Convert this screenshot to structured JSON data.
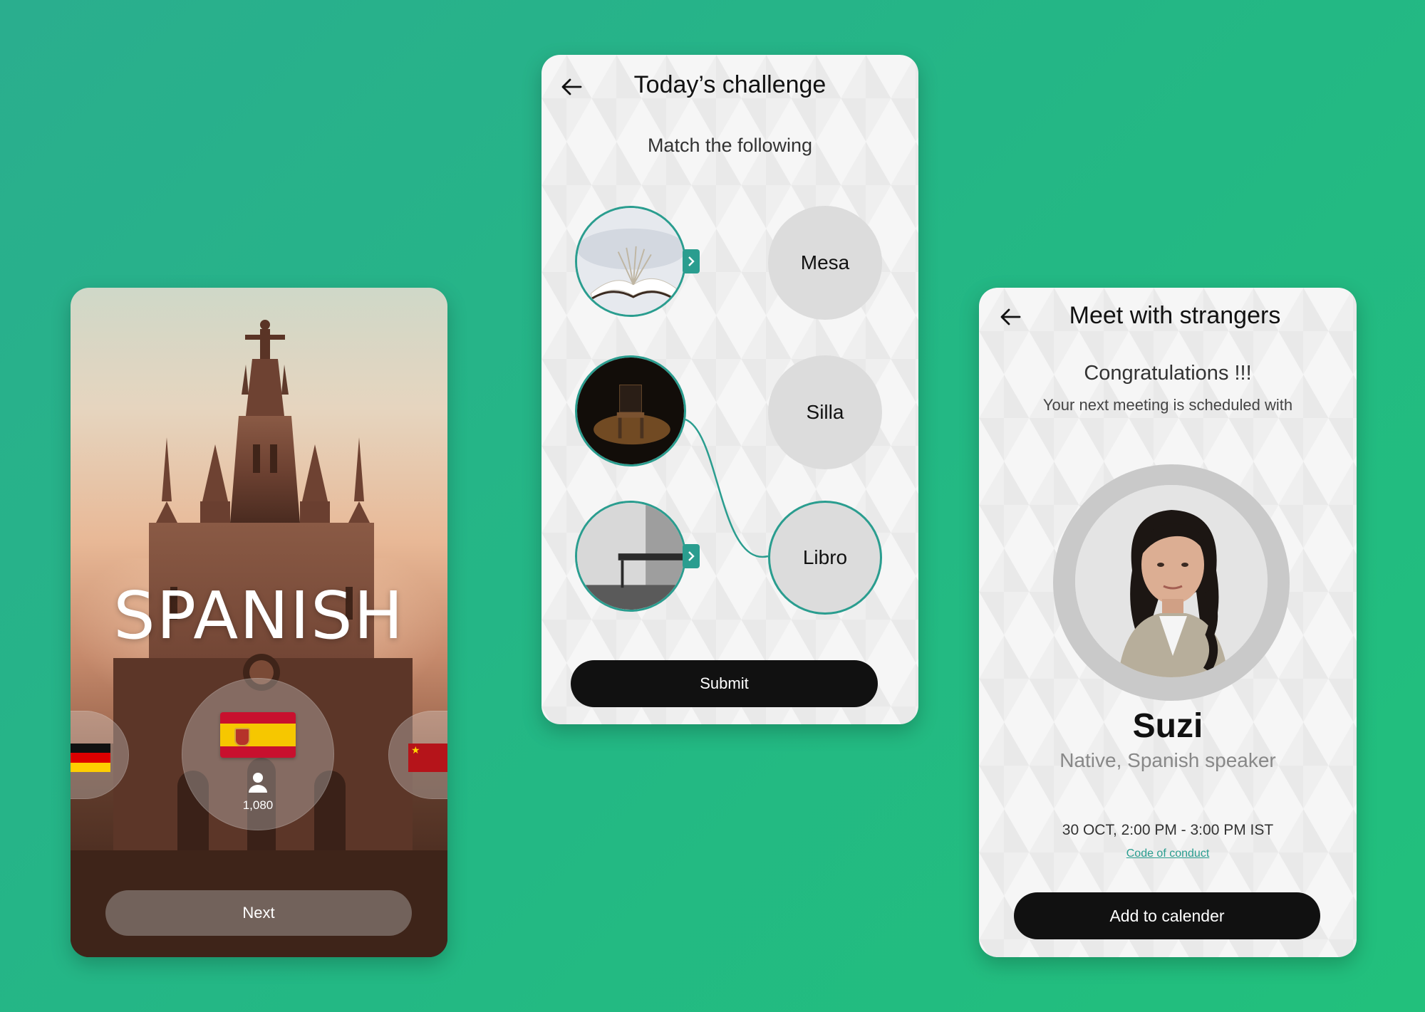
{
  "colors": {
    "background": "#24b887",
    "accent_teal": "#2a9d8f",
    "button_dark": "#111111",
    "card_bg": "#efefef"
  },
  "spanish_card": {
    "language_title": "SPANISH",
    "learner_count": "1,080",
    "next_label": "Next",
    "flags": [
      "germany-flag",
      "spain-flag",
      "china-flag"
    ]
  },
  "challenge_card": {
    "title": "Today’s challenge",
    "instruction": "Match the following",
    "images": [
      "open-book-image",
      "chair-image",
      "table-image"
    ],
    "words": [
      "Mesa",
      "Silla",
      "Libro"
    ],
    "submit_label": "Submit"
  },
  "meet_card": {
    "title": "Meet with strangers",
    "congrats": "Congratulations !!!",
    "schedule_note": "Your next meeting is scheduled with",
    "person_name": "Suzi",
    "person_role": "Native, Spanish speaker",
    "meeting_time": "30 OCT, 2:00 PM - 3:00 PM IST",
    "conduct_link": "Code of conduct",
    "calendar_label": "Add to calender"
  }
}
